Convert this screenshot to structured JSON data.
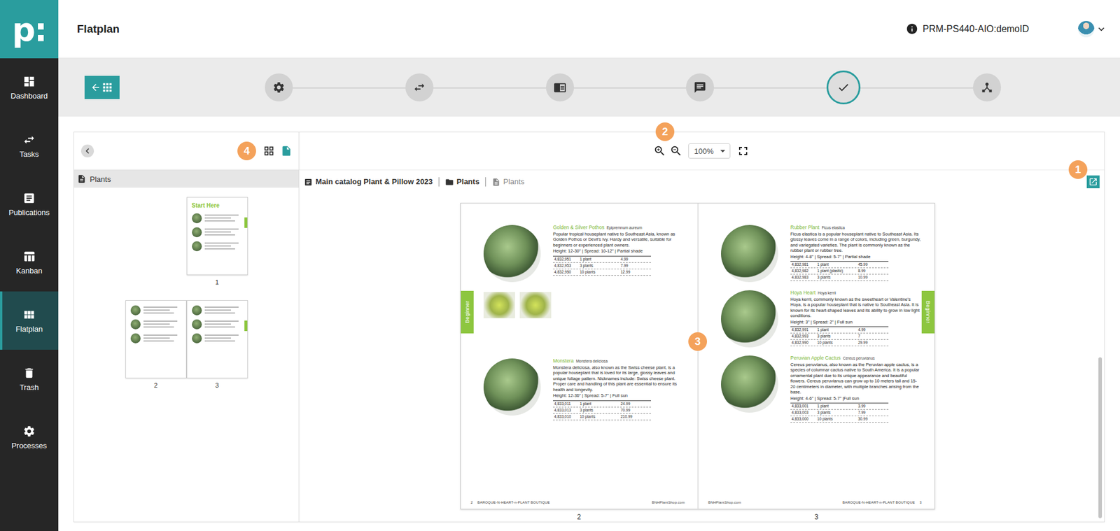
{
  "brand": {
    "logo": "p:"
  },
  "sidebar": {
    "items": [
      {
        "label": "Dashboard",
        "selected": false
      },
      {
        "label": "Tasks",
        "selected": false
      },
      {
        "label": "Publications",
        "selected": false
      },
      {
        "label": "Kanban",
        "selected": false
      },
      {
        "label": "Flatplan",
        "selected": true
      },
      {
        "label": "Trash",
        "selected": false
      },
      {
        "label": "Processes",
        "selected": false
      }
    ]
  },
  "header": {
    "title": "Flatplan",
    "workspace": "PRM-PS440-AIO:demoID"
  },
  "steps": [
    {
      "selected": false
    },
    {
      "selected": false
    },
    {
      "selected": false
    },
    {
      "selected": false
    },
    {
      "selected": true
    },
    {
      "selected": false
    }
  ],
  "left_panel": {
    "badge": "4",
    "views": [
      {
        "selected": false
      },
      {
        "selected": true
      }
    ],
    "section": "Plants",
    "thumbnails": [
      {
        "pages": [
          {
            "label": "1",
            "title": "Start Here"
          }
        ]
      },
      {
        "pages": [
          {
            "label": "2"
          },
          {
            "label": "3"
          }
        ]
      }
    ]
  },
  "toolbar": {
    "badge": "2",
    "zoom": "100%"
  },
  "breadcrumb": [
    {
      "label": "Main catalog Plant & Pillow 2023",
      "current": false
    },
    {
      "label": "Plants",
      "current": false
    },
    {
      "label": "Plants",
      "current": true
    }
  ],
  "open_badge": "1",
  "spread": {
    "badge": "3",
    "pages": [
      {
        "label": "2",
        "tab": "Beginner",
        "footer": {
          "left": [
            "2",
            "BAROQUE-N-HEART-n-PLANT BOUTIQUE"
          ],
          "right": [
            "BNHPlantShop.com"
          ]
        },
        "entries": [
          {
            "name": "Golden & Silver Pothos",
            "latin": "Epipremnum aureum",
            "description": "Popular tropical houseplant native to Southeast Asia, known as Golden Pothos or Devil's Ivy. Hardy and versatile, suitable for beginners or experienced plant owners.",
            "specs": "Height: 12-30\" | Spread: 10-12\" | Partial shade",
            "gallery": 2,
            "rows": [
              [
                "4,832,951",
                "1 plant",
                "4.99"
              ],
              [
                "4,832,953",
                "3 plants",
                "7.99"
              ],
              [
                "4,832,950",
                "10 plants",
                "12.99"
              ]
            ]
          },
          {
            "name": "Monstera",
            "latin": "Monstera deliciosa",
            "description": "Monstera deliciosa, also known as the Swiss cheese plant, is a popular houseplant that is loved for its large, glossy leaves and unique foliage pattern. Nicknames include: Swiss cheese plant. Proper care and handling of this plant are essential to ensure its health and longevity.",
            "specs": "Height: 12-36\" | Spread: 5-7\" | Full sun",
            "gallery": 0,
            "rows": [
              [
                "4,833,011",
                "1 plant",
                "24.99"
              ],
              [
                "4,833,013",
                "3 plants",
                "70.99"
              ],
              [
                "4,833,010",
                "10 plants",
                "210.99"
              ]
            ]
          }
        ]
      },
      {
        "label": "3",
        "tab": "Beginner",
        "footer": {
          "left": [
            "BNHPlantShop.com"
          ],
          "right": [
            "BAROQUE-N-HEART-n-PLANT BOUTIQUE",
            "3"
          ]
        },
        "entries": [
          {
            "name": "Rubber Plant",
            "latin": "Ficus elastica",
            "description": "Ficus elastica is a popular houseplant native to Southeast Asia. Its glossy leaves come in a range of colors, including green, burgundy, and variegated varieties. The plant is commonly known as the rubber plant or rubber tree.",
            "specs": "Height: 4-8\" | Spread: 5-7\" | Partial shade",
            "gallery": 0,
            "rows": [
              [
                "4,832,981",
                "1 plant",
                "45.99"
              ],
              [
                "4,832,982",
                "1 plant (plastic)",
                "8.99"
              ],
              [
                "4,832,983",
                "3 plants",
                "10.99"
              ]
            ]
          },
          {
            "name": "Hoya Heart",
            "latin": "Hoya kerrii",
            "description": "Hoya kerrii, commonly known as the sweetheart or Valentine's Hoya, is a popular houseplant that is native to Southeast Asia. It is known for its heart-shaped leaves and its ability to grow in low light conditions.",
            "specs": "Height: 3\" | Spread: 2\" | Full sun",
            "gallery": 0,
            "rows": [
              [
                "4,832,991",
                "1 plant",
                "4.99"
              ],
              [
                "4,832,993",
                "3 plants",
                "7"
              ],
              [
                "4,832,990",
                "10 plants",
                "29.99"
              ]
            ]
          },
          {
            "name": "Peruvian Apple Cactus",
            "latin": "Cereus peruvianus",
            "description": "Cereus peruvianus, also known as the Peruvian apple cactus, is a species of columnar cactus native to South America. It is a popular ornamental plant due to its unique appearance and beautiful flowers. Cereus peruvianus can grow up to 10 meters tall and 15-20 centimeters in diameter, with multiple branches arising from the base.",
            "specs": "Height: 4-6\" | Spread: 5-7\" |Full sun",
            "gallery": 0,
            "rows": [
              [
                "4,833,001",
                "1 plant",
                "3.99"
              ],
              [
                "4,833,003",
                "3 plants",
                "7.99"
              ],
              [
                "4,833,000",
                "10 plants",
                "30.99"
              ]
            ]
          }
        ]
      }
    ]
  }
}
